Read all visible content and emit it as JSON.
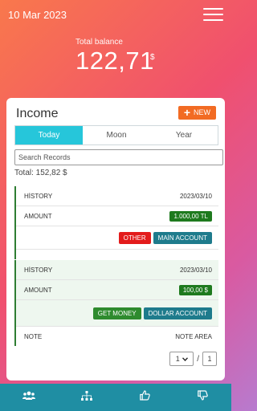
{
  "header": {
    "date": "10 Mar 2023",
    "balance_label": "Total balance",
    "balance_value": "122,71",
    "balance_currency": "$"
  },
  "card": {
    "title": "Income",
    "new_button": "NEW",
    "tabs": [
      {
        "label": "Today",
        "active": true
      },
      {
        "label": "Moon",
        "active": false
      },
      {
        "label": "Year",
        "active": false
      }
    ],
    "search_placeholder": "Search Records",
    "total": "Total: 152,82 $"
  },
  "records": [
    {
      "history_label": "HİSTORY",
      "date": "2023/03/10",
      "amount_label": "AMOUNT",
      "amount": "1.000,00 TL",
      "buttons": [
        "OTHER",
        "MAİN ACCOUNT"
      ]
    },
    {
      "history_label": "HİSTORY",
      "date": "2023/03/10",
      "amount_label": "AMOUNT",
      "amount": "100,00 $",
      "buttons": [
        "GET MONEY",
        "DOLLAR ACCOUNT"
      ],
      "note_label": "NOTE",
      "note_value": "NOTE AREA"
    }
  ],
  "pager": {
    "current": "1",
    "separator": "/",
    "total": "1"
  },
  "nav": [
    "group-icon",
    "sitemap-icon",
    "thumbs-up-icon",
    "thumbs-down-icon"
  ],
  "colors": {
    "accent_teal": "#26c6da",
    "new_button": "#f26b23",
    "amount_green": "#1e7a1e",
    "button_red": "#e31b1b",
    "button_teal": "#1e7b8c",
    "nav_bg": "#1f8ea3"
  }
}
